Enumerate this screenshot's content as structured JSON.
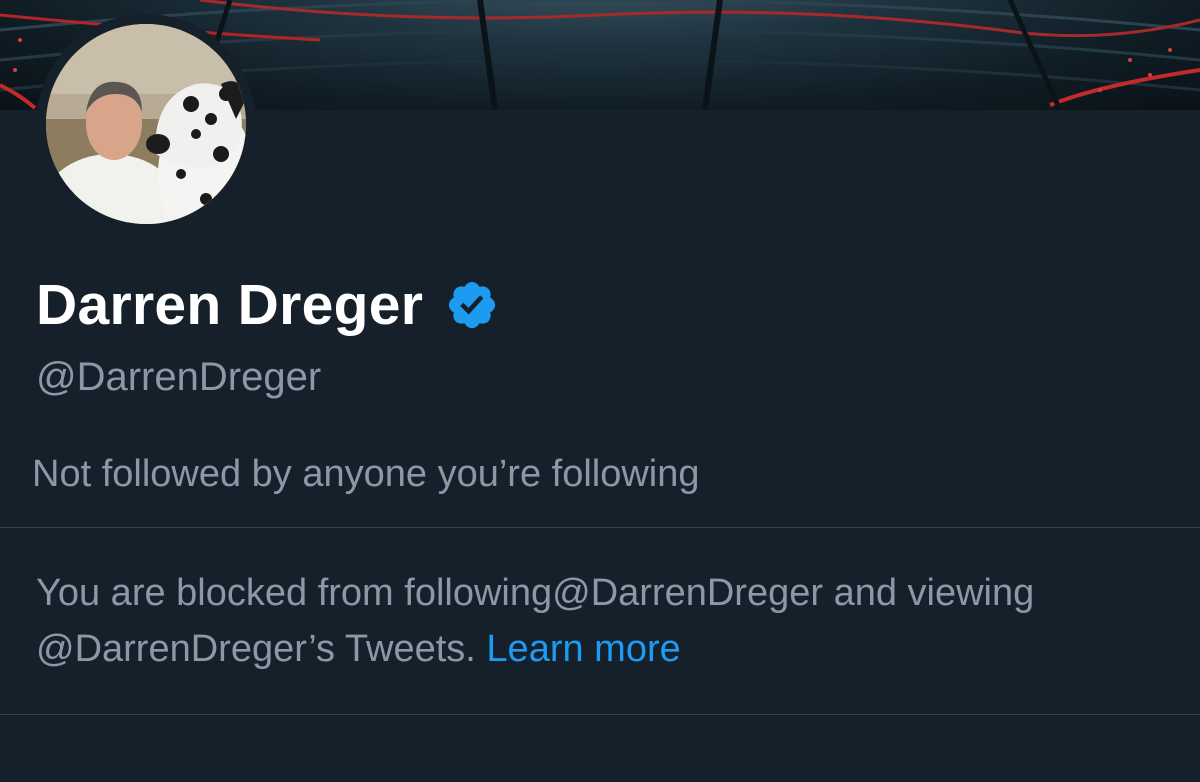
{
  "profile": {
    "display_name": "Darren Dreger",
    "handle": "@DarrenDreger",
    "verified": true,
    "followers_note": "Not followed by anyone you’re following"
  },
  "blocked_notice": {
    "text_part1": "You are blocked from following",
    "handle_a": "@DarrenDreger",
    "text_part2": " and viewing",
    "handle_b": "@DarrenDreger’s",
    "text_part3": " Tweets. ",
    "learn_more": "Learn more"
  },
  "colors": {
    "background": "#15202b",
    "primary_text": "#ffffff",
    "secondary_text": "#8b98a5",
    "accent": "#1d9bf0",
    "divider": "#38444d"
  },
  "icons": {
    "verified": "verified-badge-icon"
  }
}
